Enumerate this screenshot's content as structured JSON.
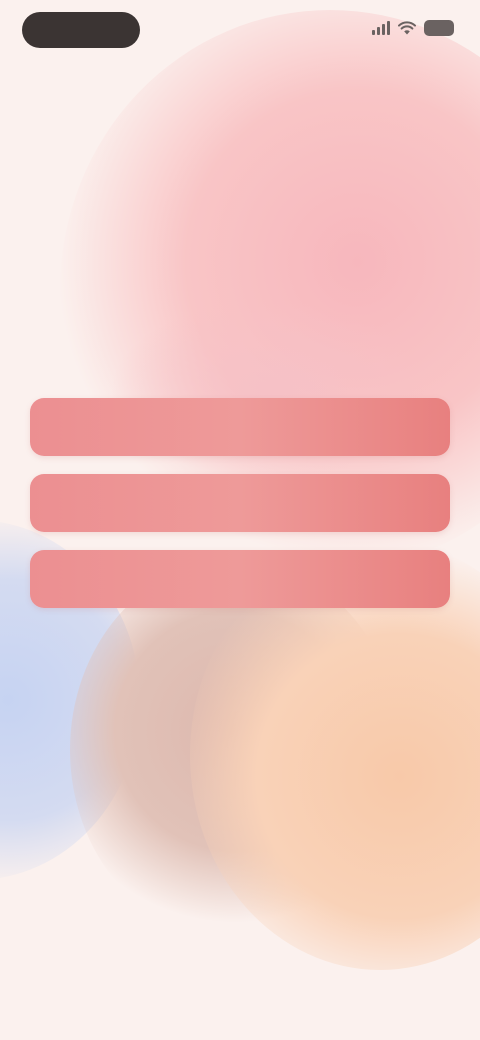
{
  "status_bar": {
    "time": ""
  },
  "headline": "",
  "subtext": "",
  "options": [
    {
      "label": ""
    },
    {
      "label": ""
    },
    {
      "label": ""
    }
  ],
  "footer": {
    "note": ""
  },
  "colors": {
    "background": "#fbf1ee",
    "accent_button": "#ec8f91",
    "headline_text": "#6b5254",
    "pink_glow": "#f7b7bd",
    "blue_glow": "#c6d3f2",
    "peach_glow": "#f8c9a9",
    "mauve_glow": "#ddb8ae"
  },
  "icons": {
    "signal": "cellular-signal-icon",
    "wifi": "wifi-icon",
    "battery": "battery-icon"
  }
}
